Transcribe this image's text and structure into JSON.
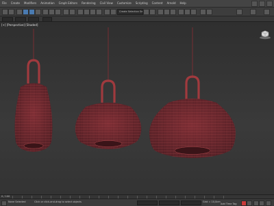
{
  "menu": {
    "items": [
      "File",
      "Create",
      "Modifiers",
      "Animation",
      "Graph Editors",
      "Rendering",
      "Civil View",
      "Customize",
      "Scripting",
      "Content",
      "Arnold",
      "Help"
    ]
  },
  "toolbar": {
    "selection_set": "Create Selection Set"
  },
  "viewport": {
    "label": "[+] [Perspective] [Shaded]"
  },
  "timeslider": {
    "frame": "0 / 100"
  },
  "status": {
    "selection": "None Selected",
    "prompt": "Click or click-and-drag to select objects",
    "grid": "Grid = 10,0cm",
    "add_time_tag": "Add Time Tag"
  },
  "colors": {
    "lamp_wire": "#a03a3e",
    "lamp_fill": "#6b2a30",
    "background": "#2b2b2b"
  }
}
